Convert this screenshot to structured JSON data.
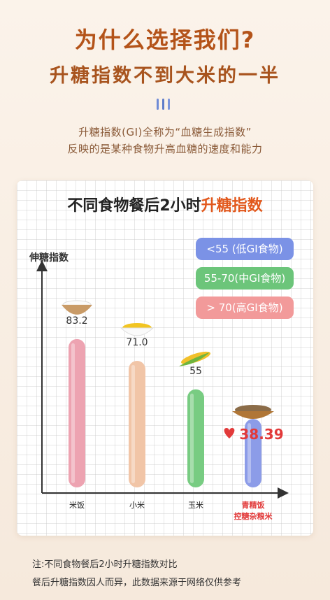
{
  "header": {
    "title": "为什么选择我们?",
    "subtitle": "升糖指数不到大米的一半",
    "accent_colors": [
      "#6f8bd6",
      "#5e7cc9",
      "#7b95dc"
    ]
  },
  "description": {
    "line1": "升糖指数(GI)全称为“血糖生成指数”",
    "line2": "反映的是某种食物升高血糖的速度和能力"
  },
  "chart": {
    "title_prefix": "不同食物餐后2小时",
    "title_highlight": "升糖指数",
    "ylabel": "伸糖指数",
    "legend": [
      {
        "label": "<55 (低GI食物)",
        "color": "#7b92e6"
      },
      {
        "label": "55-70(中GI食物)",
        "color": "#6cc57a"
      },
      {
        "label": "> 70(高GI食物)",
        "color": "#f29a9a"
      }
    ]
  },
  "chart_data": {
    "type": "bar",
    "title": "不同食物餐后2小时升糖指数",
    "ylabel": "伸糖指数",
    "categories": [
      "米饭",
      "小米",
      "玉米",
      "青精饭控糖杂粮米"
    ],
    "category_lines": [
      [
        "米饭"
      ],
      [
        "小米"
      ],
      [
        "玉米"
      ],
      [
        "青精饭",
        "控糖杂粮米"
      ]
    ],
    "values": [
      83.2,
      71.0,
      55,
      38.39
    ],
    "value_labels": [
      "83.2",
      "71.0",
      "55",
      "38.39"
    ],
    "colors": [
      "#eda3b1",
      "#f1c5a7",
      "#78cc82",
      "#8c9ce8"
    ],
    "highlight_index": 3,
    "highlight_color": "#e23a3a",
    "icons": [
      "rice-bowl-icon",
      "millet-bowl-icon",
      "corn-icon",
      "grain-bowl-icon"
    ]
  },
  "footnote": {
    "line1": "注:不同食物餐后2小时升糖指数对比",
    "line2": "餐后升糖指数因人而异，此数据来源于网络仅供参考"
  }
}
